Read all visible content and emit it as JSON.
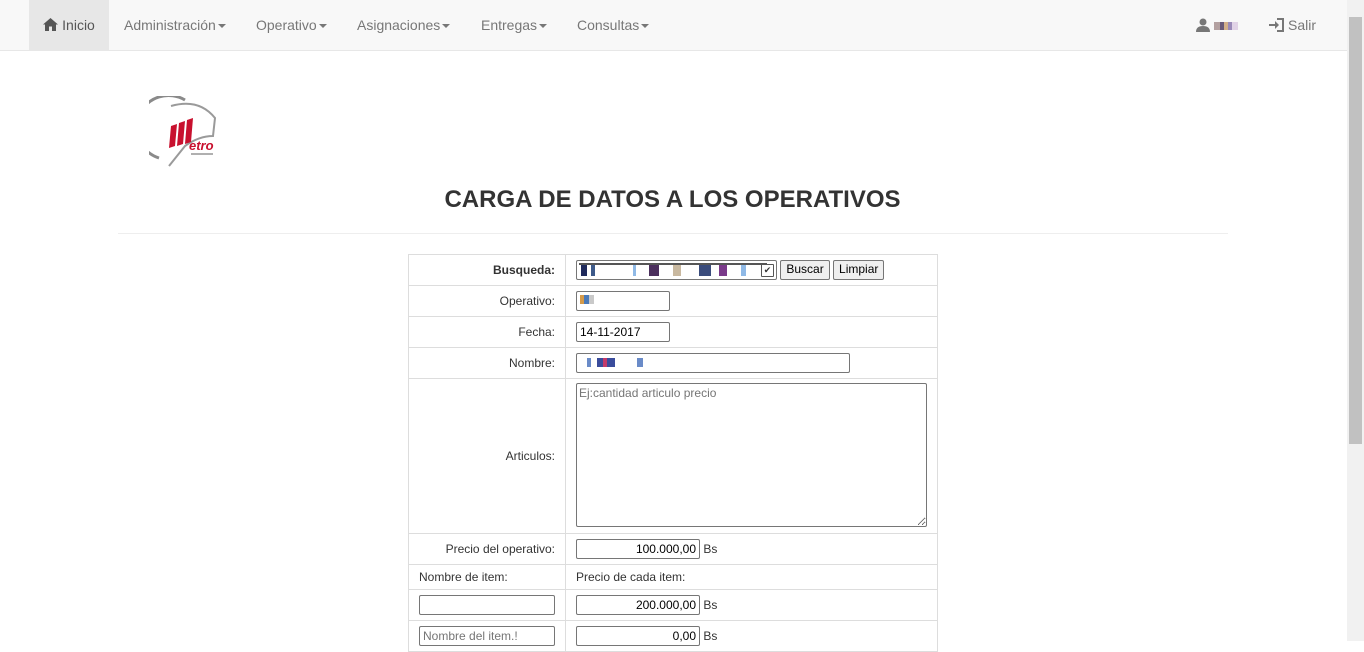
{
  "nav": {
    "home": "Inicio",
    "menus": [
      "Administración",
      "Operativo",
      "Asignaciones",
      "Entregas",
      "Consultas"
    ],
    "logout": "Salir"
  },
  "page": {
    "title": "CARGA DE DATOS A LOS OPERATIVOS"
  },
  "form": {
    "busqueda_label": "Busqueda:",
    "buscar_btn": "Buscar",
    "limpiar_btn": "Limpiar",
    "operativo_label": "Operativo:",
    "fecha_label": "Fecha:",
    "fecha_value": "14-11-2017",
    "nombre_label": "Nombre:",
    "articulos_label": "Articulos:",
    "articulos_placeholder": "Ej:cantidad articulo precio",
    "precio_operativo_label": "Precio del operativo:",
    "precio_operativo_value": "100.000,00",
    "currency": "Bs",
    "item_name_header": "Nombre de item:",
    "item_price_header": "Precio de cada item:",
    "items": [
      {
        "name": "",
        "name_placeholder": "",
        "price": "200.000,00"
      },
      {
        "name": "",
        "name_placeholder": "Nombre del item.!",
        "price": "0,00"
      }
    ]
  },
  "colors": {
    "navbar_bg": "#f8f8f8",
    "active_bg": "#e7e7e7",
    "logo_red": "#c8102e"
  }
}
